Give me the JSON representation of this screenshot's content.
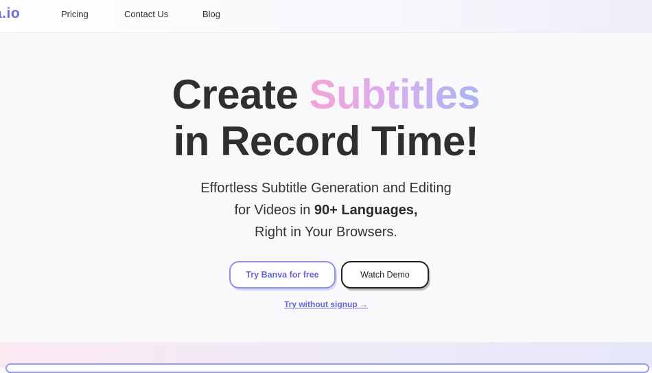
{
  "nav": {
    "logo_text": "a.io",
    "links": [
      "Pricing",
      "Contact Us",
      "Blog"
    ]
  },
  "hero": {
    "title_line1_plain": "Create",
    "title_line1_highlight": "Subtitles",
    "title_line2": "in Record Time!",
    "subtitle_line1": "Effortless Subtitle Generation and Editing",
    "subtitle_line2_plain": "for Videos in",
    "subtitle_line2_bold": "90+ Languages,",
    "subtitle_line3": "Right in Your Browsers."
  },
  "cta": {
    "primary_label": "Try Banva for free",
    "secondary_label": "Watch Demo",
    "link_label": "Try without signup →"
  },
  "colors": {
    "accent": "#6a6ed8",
    "gradient": [
      "#f3a4d8",
      "#d8afee",
      "#a9b3f2"
    ],
    "dark": "#2f2f2f"
  }
}
